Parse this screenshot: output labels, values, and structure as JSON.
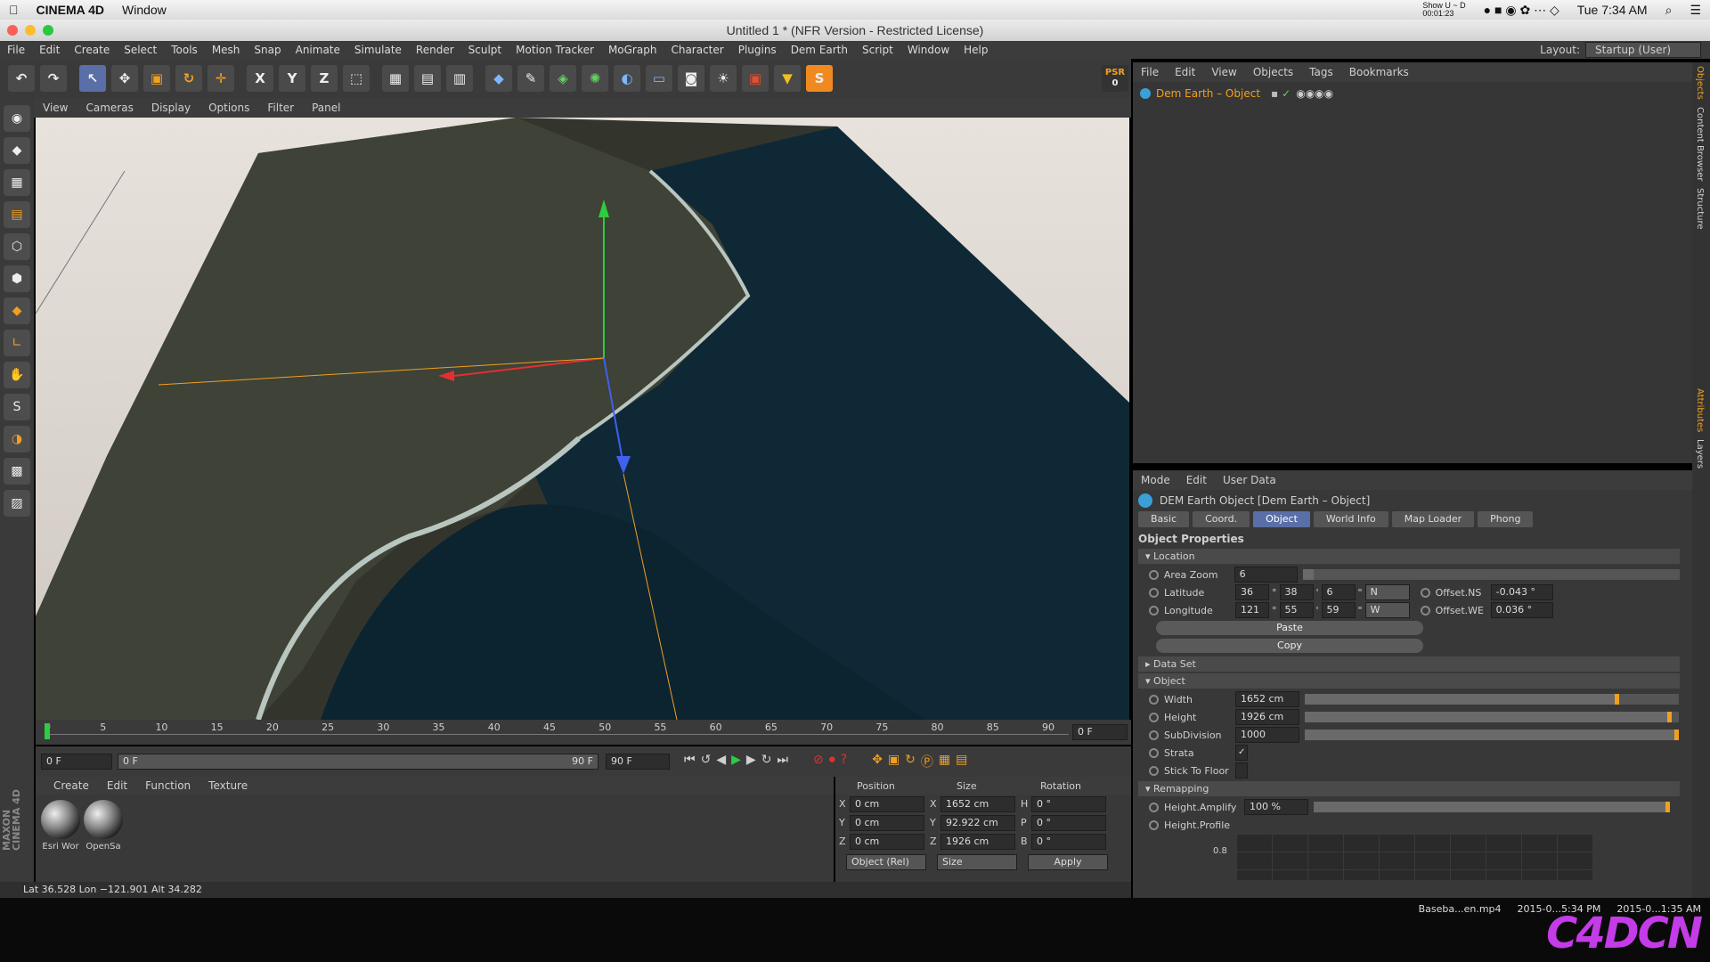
{
  "mac_menubar": {
    "app": "CINEMA 4D",
    "window_menu": "Window",
    "recording": "Show U ~ D\n00:01:23",
    "clock": "Tue 7:34 AM"
  },
  "window": {
    "title": "Untitled 1 * (NFR Version - Restricted License)"
  },
  "menubar": [
    "File",
    "Edit",
    "Create",
    "Select",
    "Tools",
    "Mesh",
    "Snap",
    "Animate",
    "Simulate",
    "Render",
    "Sculpt",
    "Motion Tracker",
    "MoGraph",
    "Character",
    "Plugins",
    "Dem Earth",
    "Script",
    "Window",
    "Help"
  ],
  "layout": {
    "label": "Layout:",
    "value": "Startup (User)"
  },
  "psr": {
    "label": "PSR",
    "value": "0"
  },
  "toolbar_axes": [
    "X",
    "Y",
    "Z"
  ],
  "viewport_menu": [
    "View",
    "Cameras",
    "Display",
    "Options",
    "Filter",
    "Panel"
  ],
  "timeline": {
    "ticks": [
      "0",
      "5",
      "10",
      "15",
      "20",
      "25",
      "30",
      "35",
      "40",
      "45",
      "50",
      "55",
      "60",
      "65",
      "70",
      "75",
      "80",
      "85",
      "90"
    ],
    "current_frame": "0 F"
  },
  "transport": {
    "start": "0 F",
    "range_start": "0 F",
    "range_end": "90 F",
    "end": "90 F"
  },
  "materials_menu": [
    "Create",
    "Edit",
    "Function",
    "Texture"
  ],
  "materials": [
    "Esri Wor",
    "OpenSa"
  ],
  "coords": {
    "headers": [
      "Position",
      "Size",
      "Rotation"
    ],
    "rows": [
      {
        "axis": "X",
        "pos": "0 cm",
        "saxis": "X",
        "size": "1652 cm",
        "raxis": "H",
        "rot": "0 °"
      },
      {
        "axis": "Y",
        "pos": "0 cm",
        "saxis": "Y",
        "size": "92.922 cm",
        "raxis": "P",
        "rot": "0 °"
      },
      {
        "axis": "Z",
        "pos": "0 cm",
        "saxis": "Z",
        "size": "1926 cm",
        "raxis": "B",
        "rot": "0 °"
      }
    ],
    "mode": "Object (Rel)",
    "size_mode": "Size",
    "apply": "Apply"
  },
  "status": "Lat 36.528   Lon −121.901   Alt 34.282",
  "objects_menu": [
    "File",
    "Edit",
    "View",
    "Objects",
    "Tags",
    "Bookmarks"
  ],
  "object_item": "Dem Earth – Object",
  "attr_menu": [
    "Mode",
    "Edit",
    "User Data"
  ],
  "attr_title": "DEM Earth Object [Dem Earth – Object]",
  "attr_tabs": [
    {
      "label": "Basic",
      "active": false
    },
    {
      "label": "Coord.",
      "active": false
    },
    {
      "label": "Object",
      "active": true
    },
    {
      "label": "World Info",
      "active": false
    },
    {
      "label": "Map Loader",
      "active": false
    },
    {
      "label": "Phong",
      "active": false
    }
  ],
  "object_properties": "Object Properties",
  "location": {
    "title": "Location",
    "area_zoom": {
      "label": "Area Zoom",
      "value": "6",
      "fill": 0.03
    },
    "latitude": {
      "label": "Latitude",
      "deg": "36",
      "min": "38",
      "sec": "6",
      "dir": "N"
    },
    "longitude": {
      "label": "Longitude",
      "deg": "121",
      "min": "55",
      "sec": "59",
      "dir": "W"
    },
    "offset_ns": {
      "label": "Offset.NS",
      "value": "-0.043 °"
    },
    "offset_we": {
      "label": "Offset.WE",
      "value": "0.036 °"
    },
    "paste": "Paste",
    "copy": "Copy",
    "symbols": {
      "deg": "°",
      "min": "'",
      "sec": "\""
    }
  },
  "data_set": "Data Set",
  "object_section": {
    "title": "Object",
    "width": {
      "label": "Width",
      "value": "1652 cm",
      "fill": 0.84
    },
    "height": {
      "label": "Height",
      "value": "1926 cm",
      "fill": 0.98
    },
    "subdivision": {
      "label": "SubDivision",
      "value": "1000",
      "fill": 1.0
    },
    "strata": {
      "label": "Strata",
      "checked": true,
      "mark": "✓"
    },
    "stick": {
      "label": "Stick To Floor",
      "checked": false
    }
  },
  "remapping": {
    "title": "Remapping",
    "amplify": {
      "label": "Height.Amplify",
      "value": "100 %",
      "fill": 1.0
    },
    "profile": {
      "label": "Height.Profile",
      "axis": "0.8"
    }
  },
  "side_tabs": [
    "Objects",
    "Content Browser",
    "Structure",
    "Attributes",
    "Layers"
  ],
  "maxon": "MAXON\nCINEMA 4D",
  "desktop": {
    "file": "Baseba...en.mp4",
    "date1": "2015-0...5:34 PM",
    "date2": "2015-0...1:35 AM",
    "watermark": "C4DCN"
  }
}
